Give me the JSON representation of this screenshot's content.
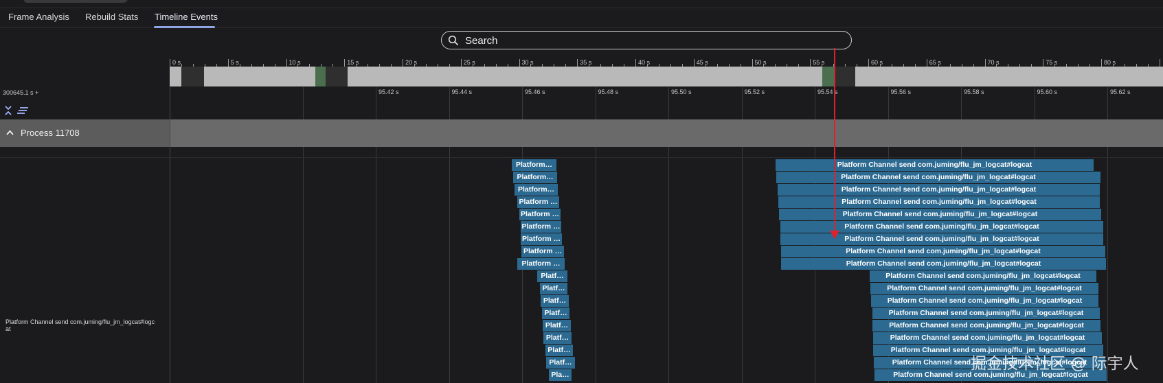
{
  "tabs": [
    {
      "label": "Frame Analysis",
      "active": false
    },
    {
      "label": "Rebuild Stats",
      "active": false
    },
    {
      "label": "Timeline Events",
      "active": true
    }
  ],
  "search": {
    "placeholder": "Search",
    "icon": "search-icon"
  },
  "ruler_labels": [
    "0 s",
    "5 s",
    "10 s",
    "15 s",
    "20 s",
    "25 s",
    "30 s",
    "35 s",
    "40 s",
    "45 s",
    "50 s",
    "55 s",
    "60 s",
    "65 s",
    "70 s",
    "75 s",
    "80 s"
  ],
  "timeline": {
    "origin_label": "300645.1 s +",
    "time_labels": [
      "95.42 s",
      "95.44 s",
      "95.46 s",
      "95.48 s",
      "95.50 s",
      "95.52 s",
      "95.54 s",
      "95.56 s",
      "95.58 s",
      "95.60 s",
      "95.62 s"
    ]
  },
  "controls": {
    "collapse_icon": "collapse-all-icon",
    "sort_icon": "list-sort-icon"
  },
  "process": {
    "name": "Process 11708",
    "icon": "chevron-up-icon"
  },
  "track": {
    "label": "Platform Channel send com.juming/flu_jm_logcat#logcat"
  },
  "events_left": [
    "Platform…",
    "Platform…",
    "Platform…",
    "Platform …",
    "Platform …",
    "Platform …",
    "Platform …",
    "Platform …",
    "Platform …",
    "Platf…",
    "Platf…",
    "Platf…",
    "Platf…",
    "Platf…",
    "Platf…",
    "Platf…",
    "Platf…",
    "Pla…"
  ],
  "events_right": [
    "Platform Channel send com.juming/flu_jm_logcat#logcat",
    "Platform Channel send com.juming/flu_jm_logcat#logcat",
    "Platform Channel send com.juming/flu_jm_logcat#logcat",
    "Platform Channel send com.juming/flu_jm_logcat#logcat",
    "Platform Channel send com.juming/flu_jm_logcat#logcat",
    "Platform Channel send com.juming/flu_jm_logcat#logcat",
    "Platform Channel send com.juming/flu_jm_logcat#logcat",
    "Platform Channel send com.juming/flu_jm_logcat#logcat",
    "Platform Channel send com.juming/flu_jm_logcat#logcat",
    "Platform Channel send com.juming/flu_jm_logcat#logcat",
    "Platform Channel send com.juming/flu_jm_logcat#logcat",
    "Platform Channel send com.juming/flu_jm_logcat#logcat",
    "Platform Channel send com.juming/flu_jm_logcat#logcat",
    "Platform Channel send com.juming/flu_jm_logcat#logcat",
    "Platform Channel send com.juming/flu_jm_logcat#logcat",
    "Platform Channel send com.juming/flu_jm_logcat#logcat",
    "Platform Channel send com.juming/flu_jm_logcat#logcat",
    "Platform Channel send com.juming/flu_jm_logcat#logcat"
  ],
  "watermark": "掘金技术社区 @ 际宇人",
  "colors": {
    "event": "#2c6a92",
    "accent": "#90a4e8",
    "arrow": "#e0202a",
    "overview_selected": "#4a6e4e"
  }
}
